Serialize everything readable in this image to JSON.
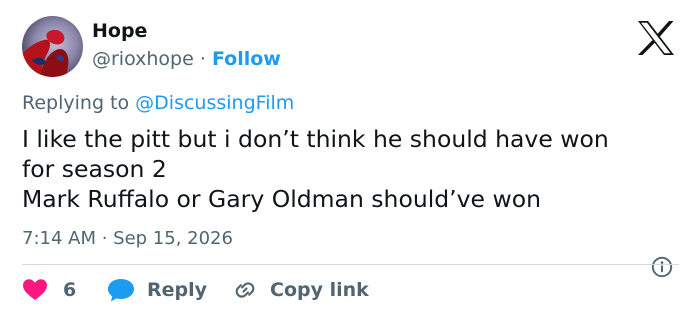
{
  "author": {
    "name": "Hope",
    "handle": "@rioxhope",
    "separator": "·",
    "follow_label": "Follow"
  },
  "reply": {
    "prefix": "Replying to",
    "mention": "@DiscussingFilm"
  },
  "tweet": {
    "lines": [
      "I like the pitt but i don’t think he should have won",
      "for season 2",
      "Mark Ruffalo or Gary Oldman should’ve won"
    ],
    "timestamp": "7:14 AM · Sep 15, 2026"
  },
  "actions": {
    "likes_count": "6",
    "reply_label": "Reply",
    "copy_link_label": "Copy link"
  },
  "icons": {
    "brand": "x-logo",
    "like": "heart-icon",
    "reply": "speech-bubble-icon",
    "copy": "link-icon",
    "info": "info-icon"
  },
  "colors": {
    "text": "#0f1419",
    "muted": "#536471",
    "accent": "#1d9bf0",
    "like": "#f91880",
    "divider": "#cfd9de"
  }
}
